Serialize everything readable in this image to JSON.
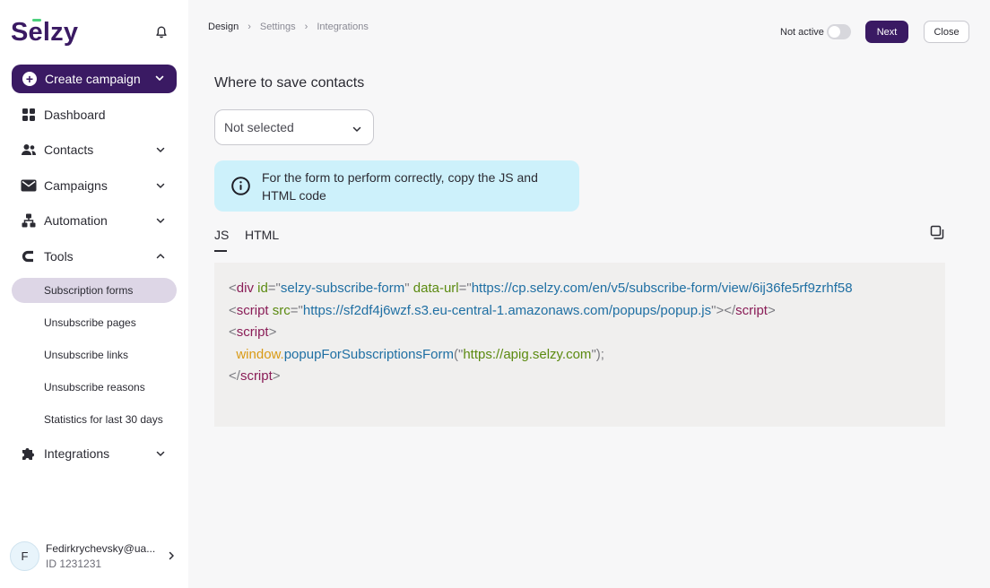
{
  "sidebar": {
    "logo": "Selzy",
    "create_campaign": "Create campaign",
    "nav": {
      "dashboard": "Dashboard",
      "contacts": "Contacts",
      "campaigns": "Campaigns",
      "automation": "Automation",
      "tools": "Tools",
      "integrations": "Integrations"
    },
    "tools_sub": {
      "subscription_forms": "Subscription forms",
      "unsubscribe_pages": "Unsubscribe pages",
      "unsubscribe_links": "Unsubscribe links",
      "unsubscribe_reasons": "Unsubscribe reasons",
      "statistics": "Statistics for last 30 days"
    },
    "user": {
      "initial": "F",
      "email": "Fedirkrychevsky@ua...",
      "id": "ID 1231231"
    }
  },
  "header": {
    "breadcrumb": [
      "Design",
      "Settings",
      "Integrations"
    ],
    "status_label": "Not active",
    "next_label": "Next",
    "close_label": "Close"
  },
  "main": {
    "section_title": "Where to save contacts",
    "select_value": "Not selected",
    "info_text": "For the form to perform correctly, copy the JS and HTML code",
    "tabs": [
      "JS",
      "HTML"
    ]
  },
  "code": {
    "line1": {
      "lt": "<",
      "tag": "div",
      "attr1": " id",
      "eq1": "=\"",
      "val1": "selzy-subscribe-form",
      "q1": "\"",
      "attr2": " data-url",
      "eq2": "=\"",
      "val2": "https://cp.selzy.com/en/v5/subscribe-form/view/6ij36fe5rf9zrhf58"
    },
    "line2": {
      "lt": "<",
      "tag": "script",
      "attr": " src",
      "eq": "=\"",
      "val": "https://sf2df4j6wzf.s3.eu-central-1.amazonaws.com/popups/popup.js",
      "close": "\"></",
      "tag_end": "script",
      "gt": ">"
    },
    "line3": {
      "lt": "<",
      "tag": "script",
      "gt": ">"
    },
    "line4": {
      "indent": "  ",
      "obj": "window",
      "dot": ".",
      "fn": "popupForSubscriptionsForm",
      "open": "(\"",
      "arg": "https://apig.selzy.com",
      "close": "\");"
    },
    "line5": {
      "lt": "</",
      "tag": "script",
      "gt": ">"
    }
  },
  "colors": {
    "brand": "#3a1a63",
    "accent_green": "#4cd07d",
    "info_bg": "#cdf1fb",
    "active_sub_bg": "#ddd6e6"
  }
}
